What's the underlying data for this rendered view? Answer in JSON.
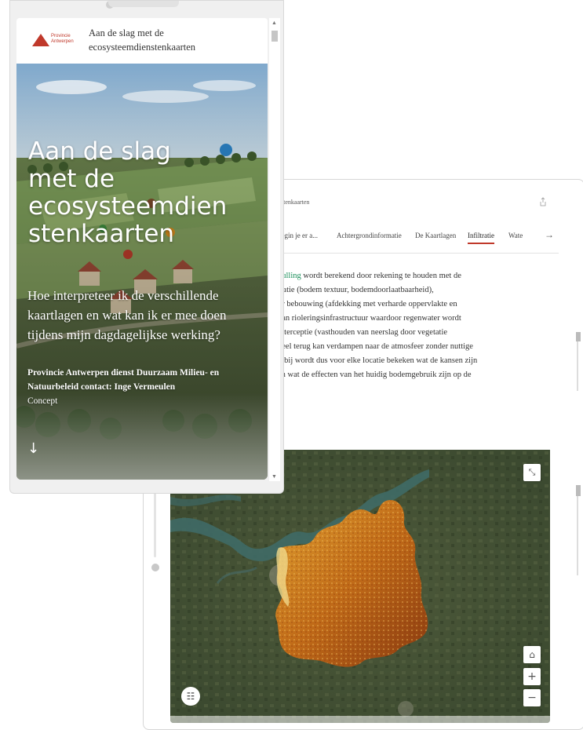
{
  "story": {
    "header_title": "Aan de slag met de ecosysteemdienstenkaarten",
    "logo_text_line1": "Provincie",
    "logo_text_line2": "Antwerpen",
    "hero_title": "Aan de slag met de ecosysteemdiensten­kaarten",
    "hero_title_lines": [
      "Aan de slag",
      "met de",
      "ecosysteemdien",
      "stenkaarten"
    ],
    "hero_subtitle": "Hoe interpreteer ik de verschillende kaartlagen en wat kan ik er mee doen tijdens mijn dagdagelijkse werking?",
    "byline": "Provincie Antwerpen dienst Duurzaam Milieu- en Natuurbeleid contact: Inge Vermeulen",
    "concept": "Concept",
    "scroll_arrow": "↓"
  },
  "back_panel": {
    "header_title_partial": "nstenkaarten",
    "nav_tabs": [
      {
        "label": "begin je er a...",
        "active": false
      },
      {
        "label": "Achtergrondinformatie",
        "active": false
      },
      {
        "label": "De Kaartlagen",
        "active": false
      },
      {
        "label": "Infiltratie",
        "active": true
      },
      {
        "label": "Wate",
        "active": false
      }
    ],
    "nav_arrow": "→",
    "body_lines": [
      {
        "link": "vulling",
        "text": " wordt berekend door rekening te houden met de"
      },
      {
        "text": "tratie (bodem textuur, bodemdoorlaatbaarheid),"
      },
      {
        "text": "or bebouwing (afdekking met verharde oppervlakte en"
      },
      {
        "text": "van rioleringsinfrastructuur waardoor regenwater wordt"
      },
      {
        "text": " interceptie (vasthouden van neerslag door vegetatie"
      },
      {
        "text": "deel terug kan verdampen naar de atmosfeer zonder nuttige"
      },
      {
        "text": "erbij wordt dus voor elke locatie bekeken wat de kansen zijn"
      },
      {
        "text": " en wat de effecten van het huidig bodemgebruik zijn op de"
      }
    ]
  },
  "map": {
    "buttons": {
      "expand": "⤡",
      "home": "⌂",
      "zoom_in": "+",
      "zoom_out": "−",
      "legend": "☷"
    }
  },
  "colors": {
    "accent_red": "#c0392b",
    "link_green": "#1a8f5a",
    "infiltration_orange": "#d4821c"
  }
}
